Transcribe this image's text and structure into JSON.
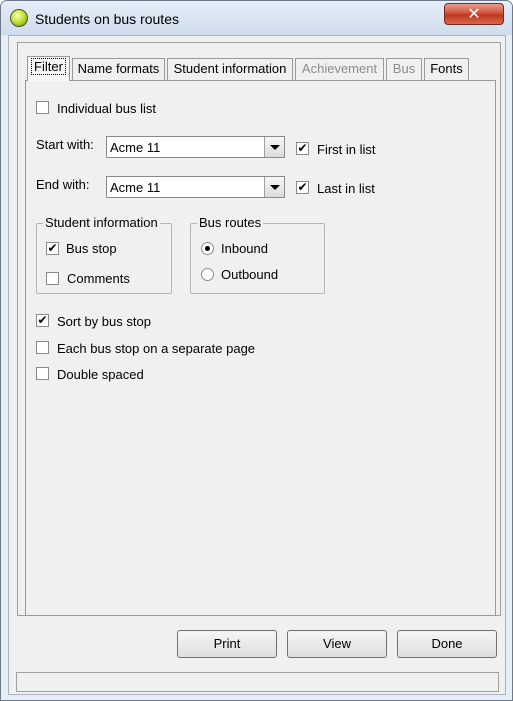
{
  "window": {
    "title": "Students on bus routes",
    "close_glyph": "✕"
  },
  "tabs": [
    {
      "label": "Filter",
      "active": true,
      "enabled": true
    },
    {
      "label": "Name formats",
      "enabled": true
    },
    {
      "label": "Student information",
      "enabled": true
    },
    {
      "label": "Achievement",
      "enabled": false
    },
    {
      "label": "Bus",
      "enabled": false
    },
    {
      "label": "Fonts",
      "enabled": true
    }
  ],
  "filter": {
    "individual_bus_list": {
      "label": "Individual bus list",
      "checked": false
    },
    "start_with": {
      "label": "Start with:",
      "value": "Acme 11"
    },
    "end_with": {
      "label": "End with:",
      "value": "Acme 11"
    },
    "first_in_list": {
      "label": "First in list",
      "checked": true
    },
    "last_in_list": {
      "label": "Last in list",
      "checked": true
    },
    "student_information": {
      "title": "Student information",
      "bus_stop": {
        "label": "Bus stop",
        "checked": true
      },
      "comments": {
        "label": "Comments",
        "checked": false
      }
    },
    "bus_routes": {
      "title": "Bus routes",
      "inbound": {
        "label": "Inbound",
        "selected": true
      },
      "outbound": {
        "label": "Outbound",
        "selected": false
      }
    },
    "sort_by_bus_stop": {
      "label": "Sort by bus stop",
      "checked": true
    },
    "each_stop_separate_page": {
      "label": "Each bus stop on a separate page",
      "checked": false
    },
    "double_spaced": {
      "label": "Double spaced",
      "checked": false
    }
  },
  "buttons": {
    "print": "Print",
    "view": "View",
    "done": "Done"
  },
  "check_glyph": "✔",
  "status": ""
}
